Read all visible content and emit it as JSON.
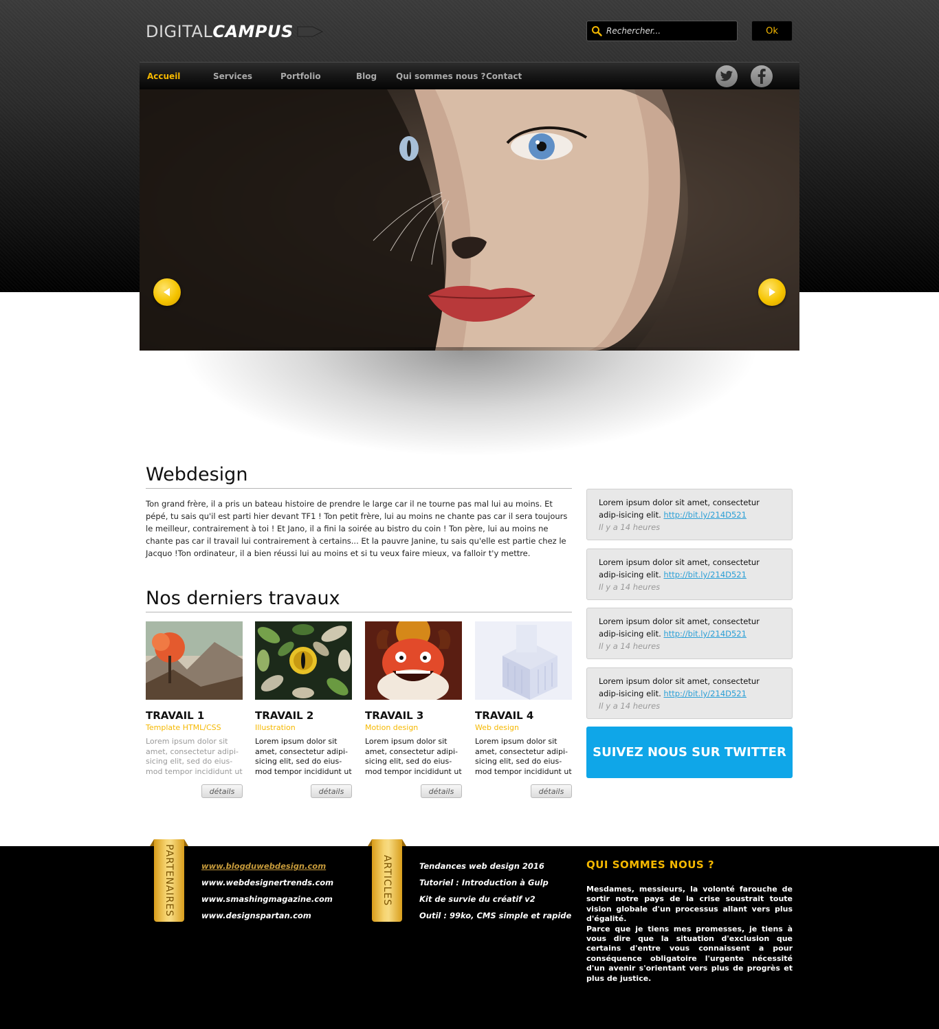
{
  "header": {
    "logo_part1": "DIGITAL",
    "logo_part2": "CAMPUS",
    "search_placeholder": "Rechercher...",
    "ok_label": "Ok"
  },
  "nav": {
    "items": [
      {
        "label": "Accueil",
        "active": true
      },
      {
        "label": "Services"
      },
      {
        "label": "Portfolio"
      },
      {
        "label": "Blog"
      },
      {
        "label": "Qui sommes nous ?"
      },
      {
        "label": "Contact"
      }
    ],
    "social": [
      "twitter-icon",
      "facebook-icon"
    ]
  },
  "colors": {
    "accent": "#f5b800",
    "twitter_blue": "#0fa6e8",
    "link": "#2a9fd6"
  },
  "intro": {
    "title": "Webdesign",
    "text": "Ton grand frère, il a pris un bateau histoire de prendre le large car il ne tourne pas mal lui au moins. Et pépé, tu sais qu'il est parti hier devant TF1 ! Ton petit frère, lui au moins ne chante pas car il sera toujours le meilleur, contrairement à toi ! Et Jano, il a fini la soirée au bistro du coin ! Ton père, lui au moins ne chante pas car il travail lui contrairement à certains... Et la pauvre Janine, tu sais qu'elle est partie chez le Jacquo !Ton ordinateur, il a bien réussi lui au moins et si tu veux faire mieux, va falloir t'y mettre."
  },
  "works": {
    "title": "Nos derniers travaux",
    "items": [
      {
        "title": "TRAVAIL 1",
        "category": "Template HTML/CSS",
        "desc": "Lorem ipsum dolor sit amet, consectetur adipi-sicing elit, sed do eius-mod tempor incididunt ut",
        "button": "détails"
      },
      {
        "title": "TRAVAIL 2",
        "category": "Illustration",
        "desc": "Lorem ipsum dolor sit amet, consectetur adipi-sicing elit, sed do eius-mod tempor incididunt ut",
        "button": "détails"
      },
      {
        "title": "TRAVAIL 3",
        "category": "Motion design",
        "desc": "Lorem ipsum dolor sit amet, consectetur adipi-sicing elit, sed do eius-mod tempor incididunt ut",
        "button": "détails"
      },
      {
        "title": "TRAVAIL 4",
        "category": "Web design",
        "desc": "Lorem ipsum dolor sit amet, consectetur adipi-sicing elit, sed do eius-mod tempor incididunt ut",
        "button": "détails"
      }
    ]
  },
  "tweets": [
    {
      "text": "Lorem ipsum dolor sit amet, consectetur adip-isicing elit.",
      "link": "http://bit.ly/214D521",
      "time": "Il y a 14 heures"
    },
    {
      "text": "Lorem ipsum dolor sit amet, consectetur adip-isicing elit.",
      "link": "http://bit.ly/214D521",
      "time": "Il y a 14 heures"
    },
    {
      "text": "Lorem ipsum dolor sit amet, consectetur adip-isicing elit.",
      "link": "http://bit.ly/214D521",
      "time": "Il y a 14 heures"
    },
    {
      "text": "Lorem ipsum dolor sit amet, consectetur adip-isicing elit.",
      "link": "http://bit.ly/214D521",
      "time": "Il y a 14 heures"
    }
  ],
  "twitter_cta": "SUIVEZ NOUS SUR TWITTER",
  "footer": {
    "partners_label": "PARTENAIRES",
    "partners": [
      "www.blogduwebdesign.com",
      "www.webdesignertrends.com",
      "www.smashingmagazine.com",
      "www.designspartan.com"
    ],
    "articles_label": "ARTICLES",
    "articles": [
      "Tendances web design 2016",
      "Tutoriel : Introduction à Gulp",
      "Kit de survie du créatif v2",
      "Outil : 99ko, CMS simple et rapide"
    ],
    "about_title": "QUI SOMMES NOUS ?",
    "about_p1": "Mesdames, messieurs, la volonté farouche de sortir notre pays de la crise soustrait toute vision globale d'un processus allant vers plus d'égalité.",
    "about_p2": "Parce que je tiens mes promesses, je tiens à vous dire que la situation d'exclusion que certains d'entre vous connaissent a pour conséquence obligatoire l'urgente nécessité d'un avenir s'orientant vers plus de progrès et plus de justice."
  }
}
